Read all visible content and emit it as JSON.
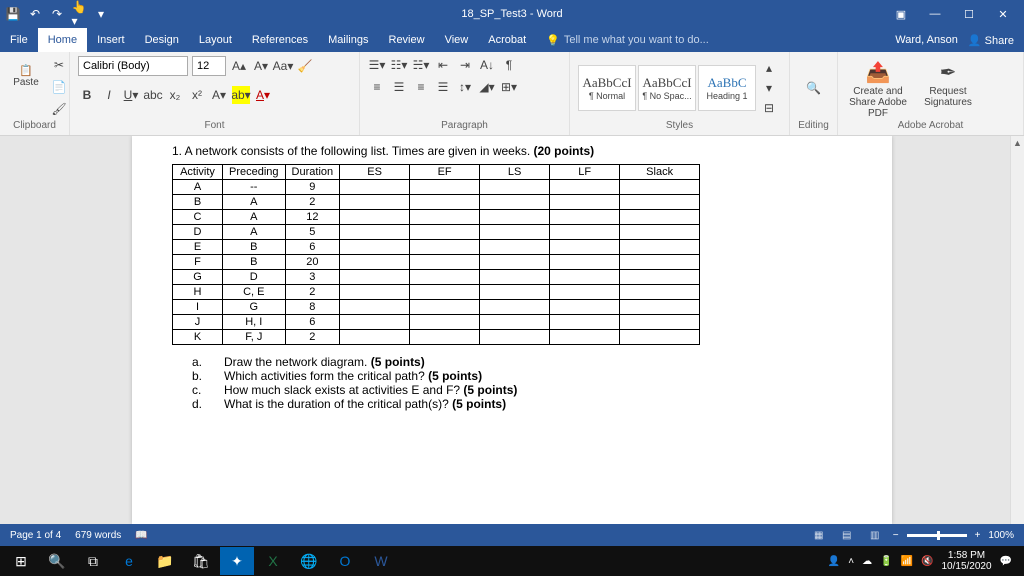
{
  "titlebar": {
    "title": "18_SP_Test3 - Word",
    "user": "Ward, Anson",
    "share": "Share"
  },
  "menu": {
    "items": [
      "File",
      "Home",
      "Insert",
      "Design",
      "Layout",
      "References",
      "Mailings",
      "Review",
      "View",
      "Acrobat"
    ],
    "tellme": "Tell me what you want to do..."
  },
  "ribbon": {
    "paste": "Paste",
    "clipboard": "Clipboard",
    "font": "Font",
    "paragraph": "Paragraph",
    "styles": "Styles",
    "editing": "Editing",
    "acrobat": "Adobe Acrobat",
    "fontname": "Calibri (Body)",
    "fontsize": "12",
    "style1": "AaBbCcI",
    "style1n": "¶ Normal",
    "style2": "AaBbCcI",
    "style2n": "¶ No Spac...",
    "style3": "AaBbC",
    "style3n": "Heading 1",
    "create": "Create and Share Adobe PDF",
    "request": "Request Signatures"
  },
  "doc": {
    "q": "1. A network consists of the following list. Times are given in weeks. ",
    "pts": "(20 points)",
    "headers": [
      "Activity",
      "Preceding",
      "Duration",
      "ES",
      "EF",
      "LS",
      "LF",
      "Slack"
    ],
    "rows": [
      [
        "A",
        "--",
        "9",
        "",
        "",
        "",
        "",
        ""
      ],
      [
        "B",
        "A",
        "2",
        "",
        "",
        "",
        "",
        ""
      ],
      [
        "C",
        "A",
        "12",
        "",
        "",
        "",
        "",
        ""
      ],
      [
        "D",
        "A",
        "5",
        "",
        "",
        "",
        "",
        ""
      ],
      [
        "E",
        "B",
        "6",
        "",
        "",
        "",
        "",
        ""
      ],
      [
        "F",
        "B",
        "20",
        "",
        "",
        "",
        "",
        ""
      ],
      [
        "G",
        "D",
        "3",
        "",
        "",
        "",
        "",
        ""
      ],
      [
        "H",
        "C, E",
        "2",
        "",
        "",
        "",
        "",
        ""
      ],
      [
        "I",
        "G",
        "8",
        "",
        "",
        "",
        "",
        ""
      ],
      [
        "J",
        "H, I",
        "6",
        "",
        "",
        "",
        "",
        ""
      ],
      [
        "K",
        "F, J",
        "2",
        "",
        "",
        "",
        "",
        ""
      ]
    ],
    "subs": [
      {
        "l": "a.",
        "t": "Draw the network diagram. ",
        "p": "(5 points)"
      },
      {
        "l": "b.",
        "t": "Which activities form the critical path? ",
        "p": "(5 points)"
      },
      {
        "l": "c.",
        "t": "How much slack exists at activities E and F? ",
        "p": "(5 points)"
      },
      {
        "l": "d.",
        "t": "What is the duration of the critical path(s)? ",
        "p": "(5 points)"
      }
    ]
  },
  "status": {
    "page": "Page 1 of 4",
    "words": "679 words",
    "zoom": "100%"
  },
  "taskbar": {
    "time": "1:58 PM",
    "date": "10/15/2020"
  }
}
